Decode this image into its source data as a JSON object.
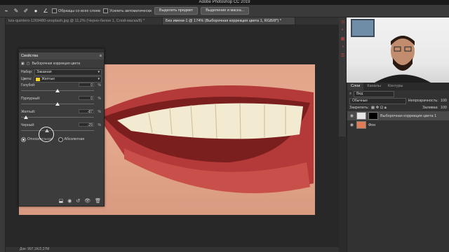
{
  "app": {
    "title": "Adobe Photoshop CC 2019"
  },
  "options_bar": {
    "sample_all_layers": "Образцы со всех слоев",
    "auto_enhance": "Усилить автоматически",
    "select_subject": "Выделить предмет",
    "select_and_mask": "Выделение и маска..."
  },
  "doc_tabs": [
    {
      "label": "luis-quintero-1269480-unsplash.jpg @ 11,2% (Черно-белое 1, Слой-маска/8) *",
      "active": false
    },
    {
      "label": "Без имени-1 @ 174% (Выборочная коррекция цвета 1, RGB/8*) *",
      "active": true
    }
  ],
  "properties": {
    "panel_title": "Свойства",
    "adjustment_name": "Выборочная коррекция цвета",
    "preset_label": "Набор:",
    "preset_value": "Заказная",
    "colors_label": "Цвета:",
    "colors_value": "Желтые",
    "colors_swatch": "#f2d21e",
    "sliders": [
      {
        "label": "Голубой:",
        "value": "0",
        "unit": "%",
        "position": 0.5
      },
      {
        "label": "Пурпурный:",
        "value": "0",
        "unit": "%",
        "position": 0.5
      },
      {
        "label": "Желтый:",
        "value": "-87",
        "unit": "%",
        "position": 0.065
      },
      {
        "label": "Черный:",
        "value": "-29",
        "unit": "%",
        "position": 0.355
      }
    ],
    "method_relative": "Относительная",
    "method_absolute": "Абсолютная"
  },
  "layers_panel": {
    "tabs": [
      "Слои",
      "Каналы",
      "Контуры"
    ],
    "kind_filter": "Вид",
    "blend_mode": "Обычные",
    "opacity_label": "Непрозрачность:",
    "opacity_value": "100",
    "lock_label": "Закрепить:",
    "fill_label": "Заливка:",
    "fill_value": "100",
    "layers": [
      {
        "name": "Выборочная коррекция цвета 1",
        "active": true
      },
      {
        "name": "Фон",
        "active": false
      }
    ]
  },
  "status": {
    "doc_info": "Док: 997,1K/2,27M"
  },
  "colors": {
    "accent": "#3a3a3a",
    "photo_skin": "#e2a48a"
  }
}
